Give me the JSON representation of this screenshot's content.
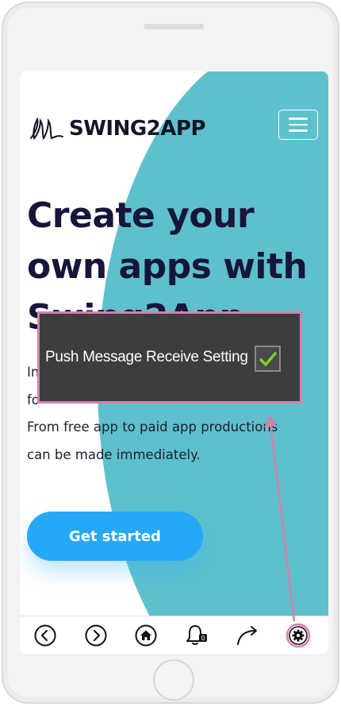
{
  "brand": {
    "logo_text": "SWING2APP"
  },
  "hero": {
    "headline": "Create your\nown apps with\nSwing2App",
    "body": "In\nfo\nFrom free app to paid app productions\ncan be made immediately.",
    "cta_label": "Get started"
  },
  "overlay": {
    "label": "Push Message Receive Setting",
    "checked": true
  },
  "bottom_nav": {
    "items": [
      {
        "name": "back",
        "icon": "chevron-left-icon"
      },
      {
        "name": "forward",
        "icon": "chevron-right-icon"
      },
      {
        "name": "home",
        "icon": "home-icon"
      },
      {
        "name": "notifications",
        "icon": "bell-icon",
        "badge": "0"
      },
      {
        "name": "share",
        "icon": "share-arrow-icon"
      },
      {
        "name": "settings",
        "icon": "gear-icon"
      }
    ]
  },
  "colors": {
    "teal": "#5ec0cc",
    "cta": "#25a9f7",
    "highlight": "#d680ad",
    "check": "#7ed321"
  }
}
